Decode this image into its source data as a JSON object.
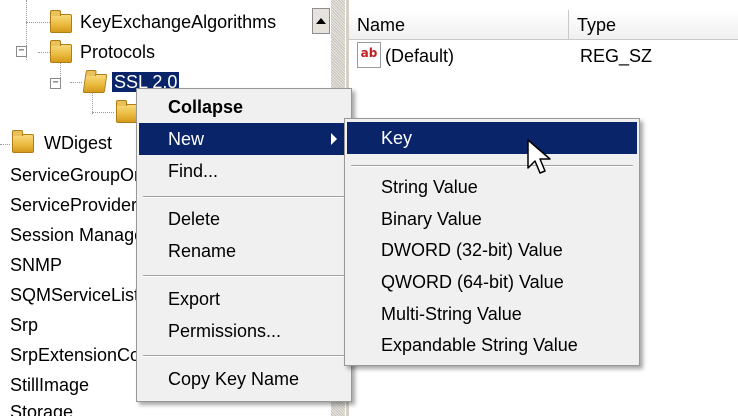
{
  "tree": {
    "items": [
      {
        "label": "KeyExchangeAlgorithms"
      },
      {
        "label": "Protocols"
      },
      {
        "label": "SSL 2.0"
      },
      {
        "label": "WDigest"
      },
      {
        "label": "ServiceGroupOrder"
      },
      {
        "label": "ServiceProvider"
      },
      {
        "label": "Session Manager"
      },
      {
        "label": "SNMP"
      },
      {
        "label": "SQMServiceList"
      },
      {
        "label": "Srp"
      },
      {
        "label": "SrpExtensionConfig"
      },
      {
        "label": "StillImage"
      },
      {
        "label": "Storage"
      }
    ],
    "expander_minus": "−"
  },
  "list": {
    "columns": {
      "name": "Name",
      "type": "Type"
    },
    "rows": [
      {
        "name": "(Default)",
        "type": "REG_SZ",
        "icon": "string-value-icon",
        "icon_text": "ab"
      }
    ]
  },
  "context_menu": {
    "items": {
      "collapse": "Collapse",
      "new": "New",
      "find": "Find...",
      "delete": "Delete",
      "rename": "Rename",
      "export": "Export",
      "permissions": "Permissions...",
      "copy_key_name": "Copy Key Name"
    }
  },
  "new_submenu": {
    "items": {
      "key": "Key",
      "string": "String Value",
      "binary": "Binary Value",
      "dword": "DWORD (32-bit) Value",
      "qword": "QWORD (64-bit) Value",
      "multi_string": "Multi-String Value",
      "expandable_string": "Expandable String Value"
    }
  },
  "colors": {
    "highlight": "#0a246a",
    "menu_bg": "#f0f0f0"
  }
}
